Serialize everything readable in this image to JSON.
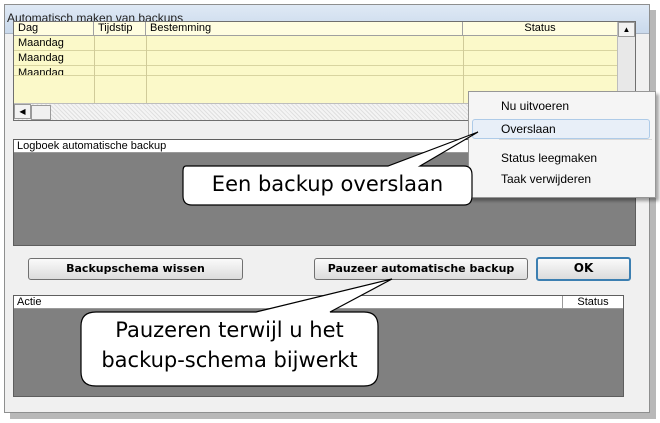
{
  "window": {
    "title": "Automatisch maken van backups"
  },
  "schedule": {
    "columns": [
      "Dag",
      "Tijdstip",
      "Bestemming",
      "Status"
    ],
    "rows": [
      {
        "dag": "Maandag",
        "tijdstip": "",
        "bestemming": "",
        "status": ""
      },
      {
        "dag": "Maandag",
        "tijdstip": "",
        "bestemming": "",
        "status": ""
      },
      {
        "dag": "Maandag",
        "tijdstip": "",
        "bestemming": "",
        "status": ""
      }
    ]
  },
  "logbook": {
    "header": "Logboek automatische backup"
  },
  "buttons": {
    "clear_schedule": "Backupschema wissen",
    "pause": "Pauzeer automatische backup",
    "ok": "OK"
  },
  "actions_table": {
    "columns": [
      "Actie",
      "Status"
    ]
  },
  "context_menu": {
    "items": [
      "Nu uitvoeren",
      "Overslaan",
      "Status leegmaken",
      "Taak verwijderen"
    ],
    "selected_index": 1
  },
  "callouts": {
    "skip": "Een backup overslaan",
    "pause_line1": "Pauzeren terwijl u het",
    "pause_line2": "backup-schema bijwerkt"
  },
  "colors": {
    "grid_bg": "#fbf9c9",
    "panel_bg": "#808080",
    "menu_highlight": "#e8eff8"
  }
}
